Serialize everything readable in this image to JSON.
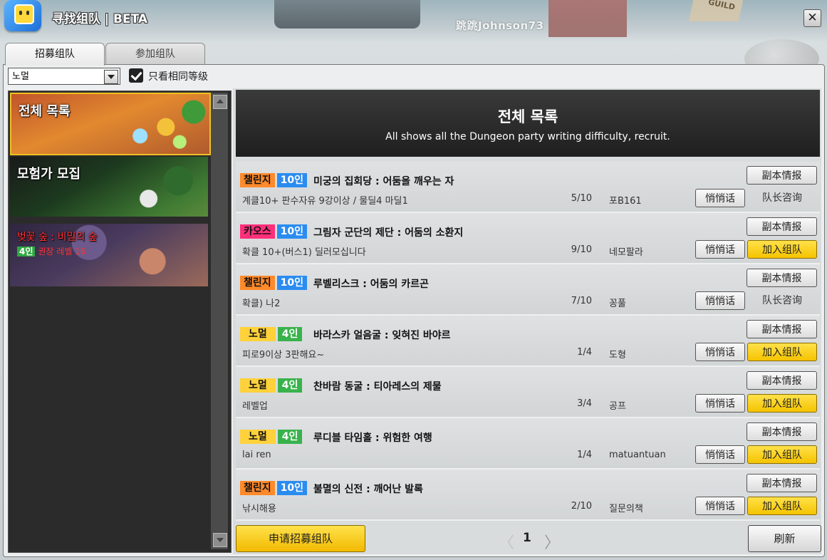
{
  "window": {
    "title": "寻找组队 | BETA",
    "close_label": "✕"
  },
  "background": {
    "player_name": "跳跳Johnson73",
    "guild_sign": "GUILD"
  },
  "tabs": [
    {
      "label": "招募组队",
      "active": true
    },
    {
      "label": "参加组队",
      "active": false
    }
  ],
  "filter": {
    "difficulty_selected": "노멀",
    "same_level_checked": true,
    "same_level_label": "只看相同等级"
  },
  "categories": [
    {
      "title": "전체 목록",
      "selected": true
    },
    {
      "title": "모험가 모집",
      "selected": false
    },
    {
      "title": "벚꽃 숲 : 비밀의 숲",
      "badge": "4인",
      "subtitle": "권장 레벨 16",
      "selected": false
    }
  ],
  "header": {
    "title": "전체 목록",
    "subtitle": "All shows all the Dungeon party writing difficulty, recruit."
  },
  "buttons": {
    "dungeon_info": "副本情报",
    "whisper": "悄悄话",
    "join": "加入组队",
    "ask_leader": "队长咨询",
    "recruit": "申请招募组队",
    "refresh": "刷新"
  },
  "parties": [
    {
      "difficulty": "챌린지",
      "diff_type": "challenge",
      "size": "10인",
      "dungeon": "미궁의 집회당 : 어둠을 깨우는 자",
      "memo": "계클10+ 판수자유 9강이상 / 물딜4 마딜1",
      "count": "5/10",
      "leader": "포B161",
      "action": "ask"
    },
    {
      "difficulty": "카오스",
      "diff_type": "chaos",
      "size": "10인",
      "dungeon": "그림자 군단의 제단 : 어둠의 소환지",
      "memo": "확클 10+(버스1) 딜러모십니다",
      "count": "9/10",
      "leader": "네모팔라",
      "action": "join"
    },
    {
      "difficulty": "챌린지",
      "diff_type": "challenge",
      "size": "10인",
      "dungeon": "루벨리스크 : 어둠의 카르곤",
      "memo": "확클) 나2",
      "count": "7/10",
      "leader": "꽁풀",
      "action": "ask"
    },
    {
      "difficulty": "노멀",
      "diff_type": "normal",
      "size": "4인",
      "dungeon": "바라스카 얼음굴 : 잊혀진 바야르",
      "memo": "피로9이상 3판해요~",
      "count": "1/4",
      "leader": "도형",
      "action": "join"
    },
    {
      "difficulty": "노멀",
      "diff_type": "normal",
      "size": "4인",
      "dungeon": "찬바람 동굴 : 티아레스의 제물",
      "memo": "레벨업",
      "count": "3/4",
      "leader": "공프",
      "action": "join"
    },
    {
      "difficulty": "노멀",
      "diff_type": "normal",
      "size": "4인",
      "dungeon": "루디블 타임홀 : 위험한 여행",
      "memo": "lai ren",
      "count": "1/4",
      "leader": "matuantuan",
      "action": "join"
    },
    {
      "difficulty": "챌린지",
      "diff_type": "challenge",
      "size": "10인",
      "dungeon": "불멸의 신전 : 깨어난 발록",
      "memo": "낚시해용",
      "count": "2/10",
      "leader": "질문의책",
      "action": "join"
    }
  ],
  "pagination": {
    "current": "1",
    "prev_icon": "chevron-left-icon",
    "next_icon": "chevron-right-icon"
  }
}
